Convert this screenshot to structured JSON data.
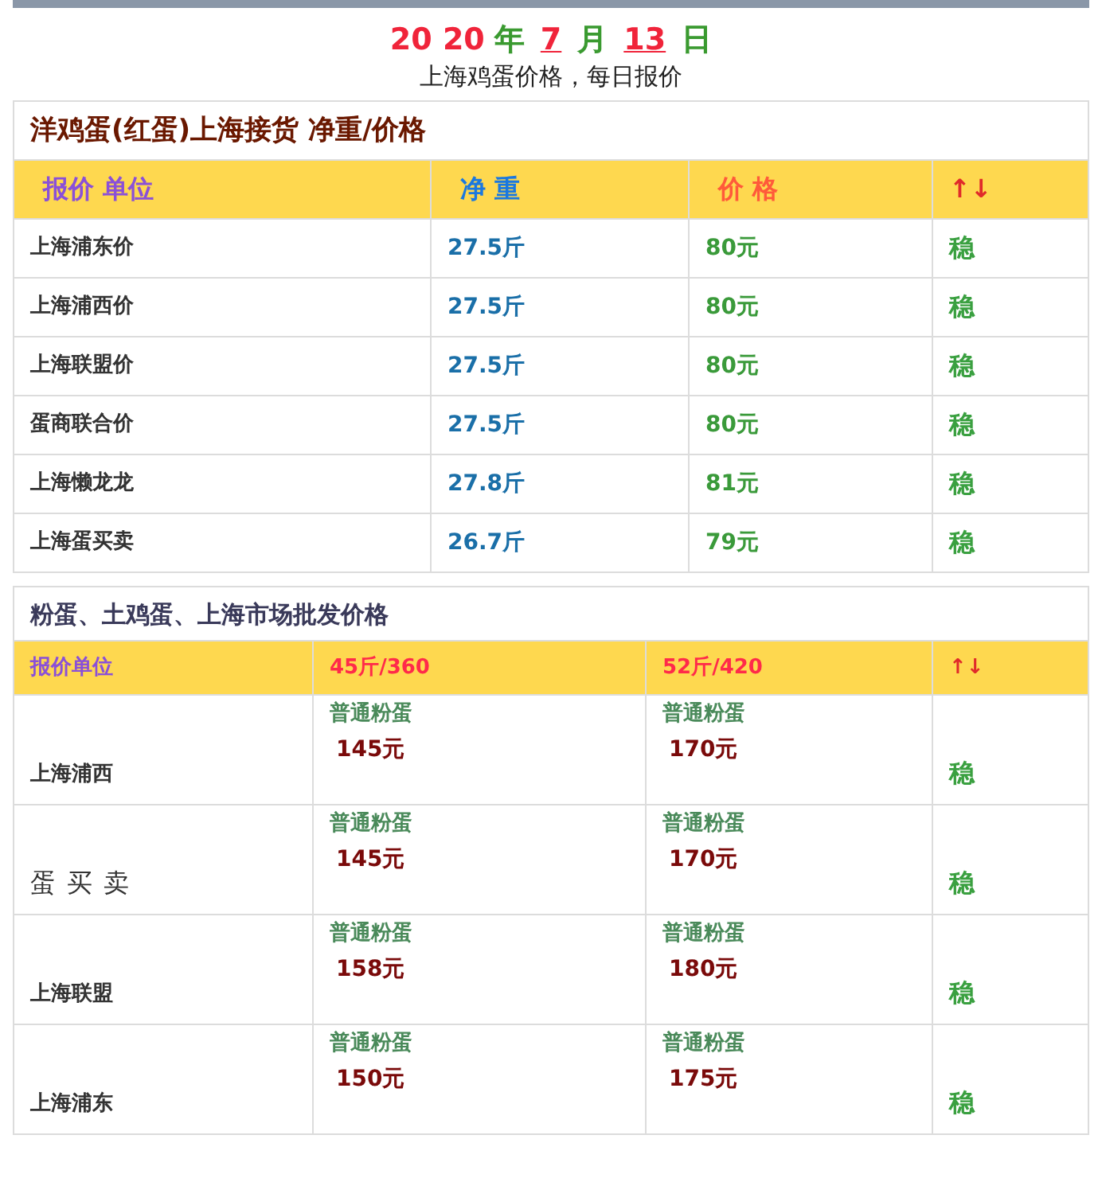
{
  "date": [
    {
      "text": "20 20",
      "kind": "number"
    },
    {
      "text": "年",
      "kind": "unit"
    },
    {
      "text": "7",
      "kind": "underlined"
    },
    {
      "text": "月",
      "kind": "unit"
    },
    {
      "text": "13",
      "kind": "underlined"
    },
    {
      "text": "日",
      "kind": "unit"
    }
  ],
  "subtitle": "上海鸡蛋价格，每日报价",
  "table1": {
    "title": "洋鸡蛋(红蛋)上海接货 净重/价格",
    "columns": [
      "报价 单位",
      "净 重",
      "价 格",
      "↑↓"
    ],
    "rows": [
      {
        "name": "上海浦东价",
        "weight": "27.5斤",
        "price": "80元",
        "trend": "稳"
      },
      {
        "name": "上海浦西价",
        "weight": "27.5斤",
        "price": "80元",
        "trend": "稳"
      },
      {
        "name": "上海联盟价",
        "weight": "27.5斤",
        "price": "80元",
        "trend": "稳"
      },
      {
        "name": "蛋商联合价",
        "weight": "27.5斤",
        "price": "80元",
        "trend": "稳"
      },
      {
        "name": "上海懒龙龙",
        "weight": "27.8斤",
        "price": "81元",
        "trend": "稳"
      },
      {
        "name": "上海蛋买卖",
        "weight": "26.7斤",
        "price": "79元",
        "trend": "稳"
      }
    ]
  },
  "table2": {
    "title": "粉蛋、土鸡蛋、上海市场批发价格",
    "columns": [
      "报价单位",
      "45斤/360",
      "52斤/420",
      "↑↓"
    ],
    "rows": [
      {
        "name": "上海浦西",
        "large": false,
        "offers": [
          {
            "label": "普通粉蛋",
            "price": "145元"
          },
          {
            "label": "普通粉蛋",
            "price": "170元"
          }
        ],
        "trend": "稳"
      },
      {
        "name": "蛋 买 卖",
        "large": true,
        "offers": [
          {
            "label": "普通粉蛋",
            "price": "145元"
          },
          {
            "label": "普通粉蛋",
            "price": "170元"
          }
        ],
        "trend": "稳"
      },
      {
        "name": "上海联盟",
        "large": false,
        "offers": [
          {
            "label": "普通粉蛋",
            "price": "158元"
          },
          {
            "label": "普通粉蛋",
            "price": "180元"
          }
        ],
        "trend": "稳"
      },
      {
        "name": "上海浦东",
        "large": false,
        "offers": [
          {
            "label": "普通粉蛋",
            "price": "150元"
          },
          {
            "label": "普通粉蛋",
            "price": "175元"
          }
        ],
        "trend": "稳"
      }
    ]
  }
}
